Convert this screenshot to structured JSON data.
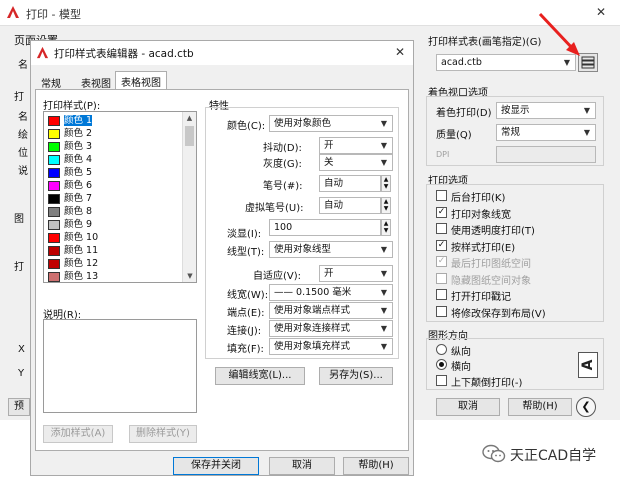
{
  "bg_window": {
    "title": "打印 - 模型",
    "close": "✕",
    "page_setup_label": "页面设置",
    "side_letters": [
      "名",
      "打",
      "名",
      "绘",
      "位",
      "说",
      "图",
      "打",
      "X",
      "Y"
    ],
    "bottom_left_button": "预",
    "cancel_button": "取消",
    "help_button": "帮助(H)"
  },
  "right_panel": {
    "plot_style_table": {
      "title": "打印样式表(画笔指定)(G)",
      "value": "acad.ctb"
    },
    "shaded_viewport": {
      "title": "着色视口选项",
      "shade_plot_label": "着色打印(D)",
      "shade_plot_value": "按显示",
      "quality_label": "质量(Q)",
      "quality_value": "常规",
      "dpi_label": "DPI"
    },
    "plot_options": {
      "title": "打印选项",
      "items": [
        {
          "label": "后台打印(K)",
          "checked": false,
          "disabled": false
        },
        {
          "label": "打印对象线宽",
          "checked": true,
          "disabled": false
        },
        {
          "label": "使用透明度打印(T)",
          "checked": false,
          "disabled": false
        },
        {
          "label": "按样式打印(E)",
          "checked": true,
          "disabled": false
        },
        {
          "label": "最后打印图纸空间",
          "checked": true,
          "disabled": true
        },
        {
          "label": "隐藏图纸空间对象",
          "checked": false,
          "disabled": true
        },
        {
          "label": "打开打印戳记",
          "checked": false,
          "disabled": false
        },
        {
          "label": "将修改保存到布局(V)",
          "checked": false,
          "disabled": false
        }
      ]
    },
    "orientation": {
      "title": "图形方向",
      "portrait": "纵向",
      "landscape": "横向",
      "upside_down": "上下颠倒打印(-)",
      "preview_letter": "A"
    }
  },
  "editor": {
    "title": "打印样式表编辑器 - acad.ctb",
    "close": "✕",
    "tabs": [
      "常规",
      "表视图",
      "表格视图"
    ],
    "active_tab": 2,
    "styles_label": "打印样式(P):",
    "styles": [
      {
        "name": "颜色 1",
        "color": "#ff0000"
      },
      {
        "name": "颜色 2",
        "color": "#ffff00"
      },
      {
        "name": "颜色 3",
        "color": "#00ff00"
      },
      {
        "name": "颜色 4",
        "color": "#00ffff"
      },
      {
        "name": "颜色 5",
        "color": "#0000ff"
      },
      {
        "name": "颜色 6",
        "color": "#ff00ff"
      },
      {
        "name": "颜色 7",
        "color": "#000000"
      },
      {
        "name": "颜色 8",
        "color": "#808080"
      },
      {
        "name": "颜色 9",
        "color": "#c0c0c0"
      },
      {
        "name": "颜色 10",
        "color": "#ff0000"
      },
      {
        "name": "颜色 11",
        "color": "#bd0000"
      },
      {
        "name": "颜色 12",
        "color": "#c00000"
      },
      {
        "name": "颜色 13",
        "color": "#cd7070"
      }
    ],
    "desc_label": "说明(R):",
    "add_style": "添加样式(A)",
    "delete_style": "删除样式(Y)",
    "props_title": "特性",
    "props": {
      "color_label": "颜色(C):",
      "color_value": "使用对象颜色",
      "dither_label": "抖动(D):",
      "dither_value": "开",
      "grayscale_label": "灰度(G):",
      "grayscale_value": "关",
      "pen_label": "笔号(#):",
      "pen_value": "自动",
      "vpen_label": "虚拟笔号(U):",
      "vpen_value": "自动",
      "screening_label": "淡显(I):",
      "screening_value": "100",
      "linetype_label": "线型(T):",
      "linetype_value": "使用对象线型",
      "adaptive_label": "自适应(V):",
      "adaptive_value": "开",
      "lineweight_label": "线宽(W):",
      "lineweight_value": "—— 0.1500 毫米",
      "endstyle_label": "端点(E):",
      "endstyle_value": "使用对象端点样式",
      "joinstyle_label": "连接(J):",
      "joinstyle_value": "使用对象连接样式",
      "fill_label": "填充(F):",
      "fill_value": "使用对象填充样式"
    },
    "edit_lineweights": "编辑线宽(L)...",
    "save_as": "另存为(S)...",
    "save_close": "保存并关闭",
    "cancel": "取消",
    "help": "帮助(H)"
  },
  "watermark": {
    "text": "天正CAD自学"
  },
  "colors": {
    "accent_red": "#e8201e",
    "selection": "#0078d7",
    "autocad_red": "#d62728"
  }
}
